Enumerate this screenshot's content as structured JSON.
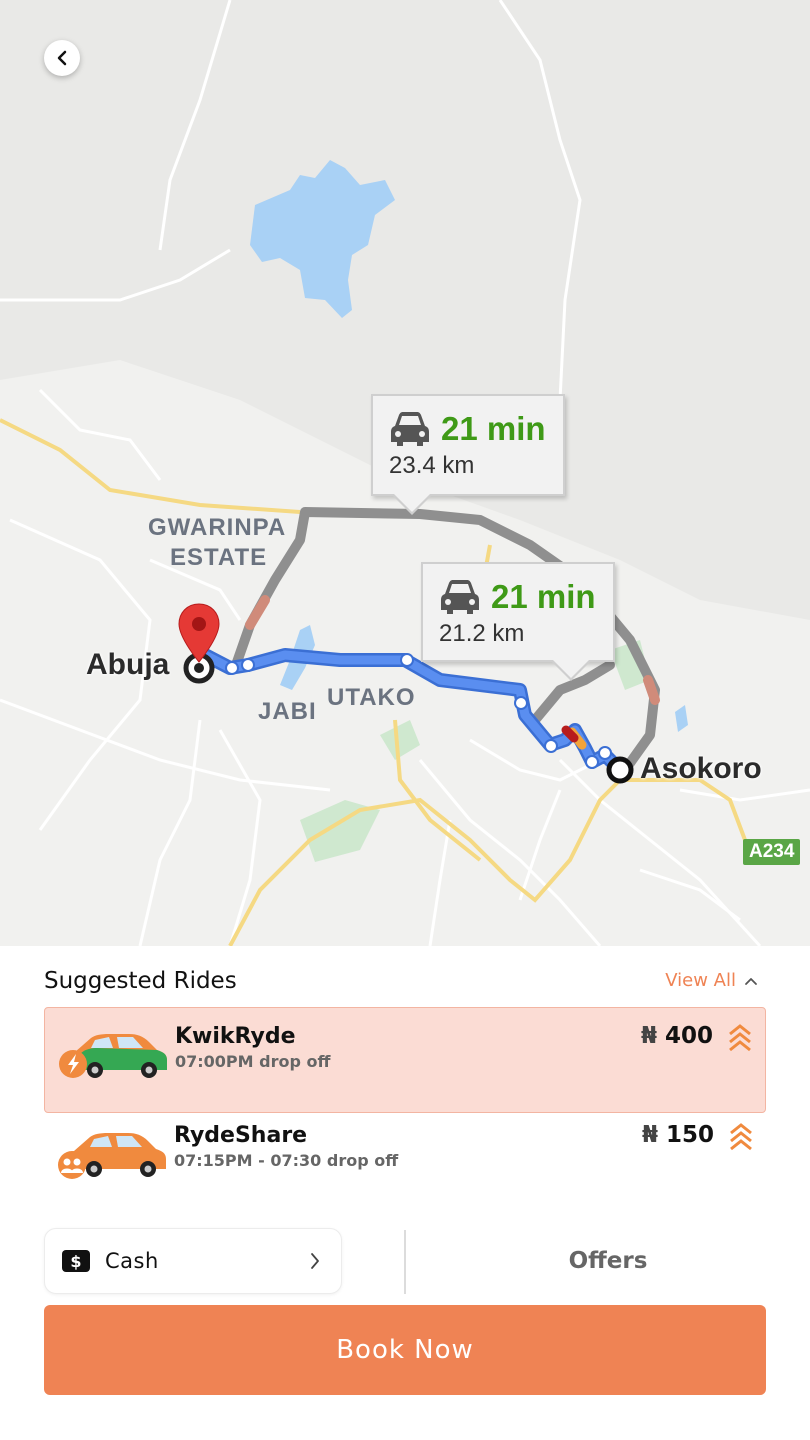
{
  "map": {
    "back_icon": "chevron-left-icon",
    "routes": [
      {
        "time": "21 min",
        "distance": "23.4 km",
        "icon": "car-icon"
      },
      {
        "time": "21 min",
        "distance": "21.2 km",
        "icon": "car-icon"
      }
    ],
    "areas": [
      "GWARINPA",
      "ESTATE",
      "JABI",
      "UTAKO"
    ],
    "origin": "Abuja",
    "destination": "Asokoro",
    "road_badge": "A234",
    "colors": {
      "route_primary": "#4d7fe0",
      "route_alt": "#9e9e9e",
      "pin": "#e53935",
      "eta_text": "#3f9a17"
    }
  },
  "suggested": {
    "title": "Suggested Rides",
    "view_all": "View All",
    "rides": [
      {
        "name": "KwikRyde",
        "detail": "07:00PM drop off",
        "currency": "₦",
        "price": "400",
        "selected": true,
        "car_color": "#35a853",
        "icon": "flash-icon"
      },
      {
        "name": "RydeShare",
        "detail": "07:15PM - 07:30 drop off",
        "currency": "₦",
        "price": "150",
        "selected": false,
        "car_color": "#f08a3e",
        "icon": "people-icon"
      }
    ]
  },
  "payment": {
    "method": "Cash",
    "icon": "cash-icon",
    "offers_label": "Offers"
  },
  "book_label": "Book Now",
  "accent_color": "#ef8354"
}
